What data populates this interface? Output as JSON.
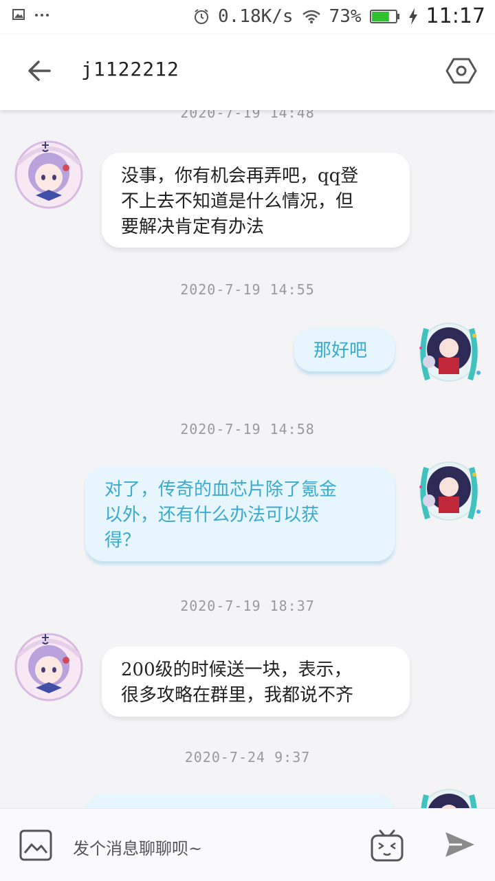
{
  "status_bar": {
    "speed": "0.18K/s",
    "battery_percent": "73%",
    "battery_level": 0.73,
    "time": "11:17",
    "icons": [
      "image-icon",
      "more-dots-icon",
      "alarm-icon",
      "wifi-icon",
      "battery-icon",
      "charging-icon"
    ]
  },
  "header": {
    "title": "j1122212",
    "back_icon": "arrow-left-icon",
    "settings_icon": "hexagon-settings-icon"
  },
  "messages": [
    {
      "type": "timestamp",
      "text": "2020-7-19 14:48"
    },
    {
      "type": "message",
      "side": "left",
      "lines": [
        "没事，你有机会再弄吧，qq登",
        "不上去不知道是什么情况，但",
        "要解决肯定有办法"
      ]
    },
    {
      "type": "timestamp",
      "text": "2020-7-19 14:55"
    },
    {
      "type": "message",
      "side": "right",
      "lines": [
        "那好吧"
      ]
    },
    {
      "type": "timestamp",
      "text": "2020-7-19 14:58"
    },
    {
      "type": "message",
      "side": "right",
      "lines": [
        "对了，传奇的血芯片除了氪金",
        "以外，还有什么办法可以获",
        "得？"
      ]
    },
    {
      "type": "timestamp",
      "text": "2020-7-19 18:37"
    },
    {
      "type": "message",
      "side": "left",
      "lines": [
        "200级的时候送一块，表示，",
        "很多攻略在群里，我都说不齐"
      ]
    },
    {
      "type": "timestamp",
      "text": "2020-7-24 9:37"
    }
  ],
  "input": {
    "placeholder": "发个消息聊聊呗~",
    "image_icon": "image-picker-icon",
    "emoji_icon": "bilibili-tv-emoji-icon",
    "send_icon": "send-arrow-icon"
  },
  "colors": {
    "accent": "#3ba9d0",
    "right_bubble_bg": "#e6f6fc",
    "left_bubble_bg": "#ffffff",
    "background": "#f4f4f6"
  }
}
